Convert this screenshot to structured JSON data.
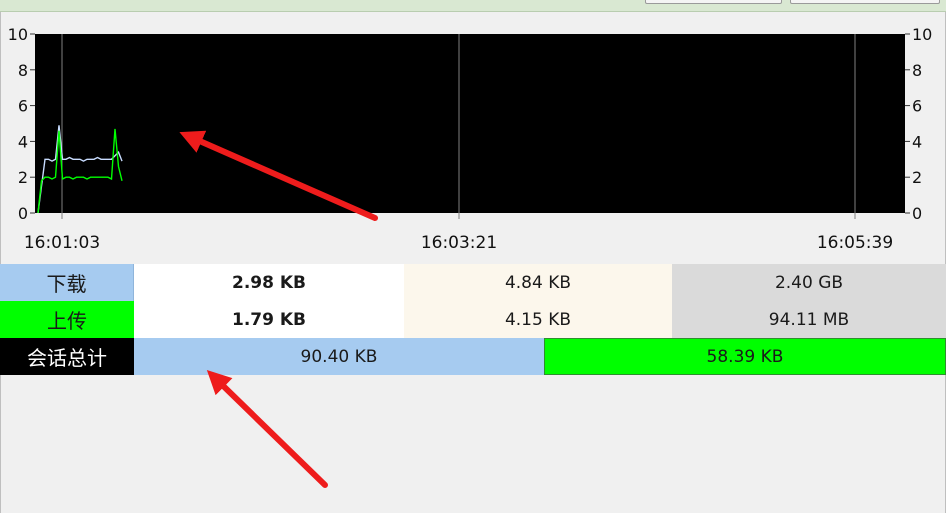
{
  "graph": {
    "y_ticks": [
      "0",
      "2",
      "4",
      "6",
      "8",
      "10"
    ],
    "y_max": 10,
    "time_labels": [
      "16:01:03",
      "16:03:21",
      "16:05:39"
    ],
    "colors": {
      "background": "#000000",
      "grid": "#808080",
      "download_line": "#c8dcff",
      "upload_line": "#00ff00"
    },
    "download_series": [
      0,
      1.5,
      3,
      3,
      2.9,
      3,
      4.9,
      3,
      3,
      3.1,
      3,
      3,
      3,
      2.9,
      3,
      3,
      3,
      3.1,
      3,
      3,
      3,
      3,
      3.2,
      3.4,
      2.9
    ],
    "upload_series": [
      0,
      1.8,
      2,
      2,
      1.9,
      2,
      4.6,
      1.9,
      2,
      2,
      1.9,
      2,
      2,
      2,
      1.9,
      2,
      2,
      2,
      2,
      2,
      2,
      1.9,
      4.7,
      2.6,
      1.8
    ]
  },
  "stats": {
    "download": {
      "label": "下载",
      "current": "2.98 KB",
      "peak": "4.84 KB",
      "total": "2.40 GB",
      "label_bg": "#a6cbf0"
    },
    "upload": {
      "label": "上传",
      "current": "1.79 KB",
      "peak": "4.15 KB",
      "total": "94.11 MB",
      "label_bg": "#00ff00"
    },
    "session": {
      "label": "会话总计",
      "download_total": "90.40 KB",
      "upload_total": "58.39 KB",
      "download_bg": "#a6cbf0",
      "upload_bg": "#00ff00",
      "label_bg": "#000000",
      "download_share": 0.505
    }
  }
}
